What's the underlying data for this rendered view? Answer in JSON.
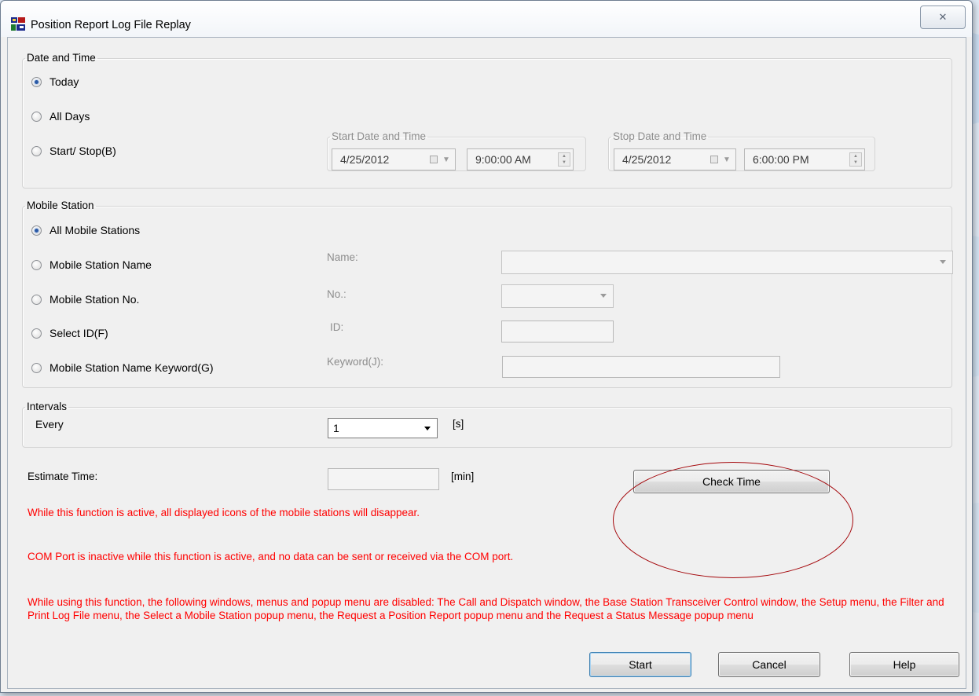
{
  "window": {
    "title": "Position Report Log File Replay",
    "close_glyph": "✕"
  },
  "date_time": {
    "legend": "Date and Time",
    "options": [
      {
        "label": "Today",
        "checked": true
      },
      {
        "label": "All Days",
        "checked": false
      },
      {
        "label": "Start/ Stop(B)",
        "checked": false
      }
    ],
    "start": {
      "legend": "Start Date and Time",
      "date": "4/25/2012",
      "time": "9:00:00 AM"
    },
    "stop": {
      "legend": "Stop Date and Time",
      "date": "4/25/2012",
      "time": "6:00:00 PM"
    }
  },
  "mobile_station": {
    "legend": "Mobile Station",
    "options": [
      {
        "label": "All Mobile Stations",
        "checked": true
      },
      {
        "label": "Mobile Station Name",
        "checked": false
      },
      {
        "label": "Mobile Station No.",
        "checked": false
      },
      {
        "label": "Select ID(F)",
        "checked": false
      },
      {
        "label": "Mobile Station Name Keyword(G)",
        "checked": false
      }
    ],
    "fields": {
      "name_label": "Name:",
      "no_label": "No.:",
      "id_label": "ID:",
      "keyword_label": "Keyword(J):"
    }
  },
  "intervals": {
    "legend": "Intervals",
    "every_label": "Every",
    "value": "1",
    "unit": "[s]"
  },
  "estimate": {
    "label": "Estimate Time:",
    "value": "",
    "unit": "[min]",
    "check_button": "Check Time"
  },
  "warnings": [
    "While this function is active, all displayed icons of the mobile stations will disappear.",
    "COM Port is inactive while this function is active, and no data can be sent or received via the COM port.",
    "While using this function, the following windows, menus and popup menu are disabled:  The Call and Dispatch window, the Base Station Transceiver Control window, the Setup menu, the Filter and Print Log File menu, the Select a Mobile Station popup menu, the Request a Position Report popup menu and the Request a Status Message popup menu"
  ],
  "buttons": {
    "start": "Start",
    "cancel": "Cancel",
    "help": "Help"
  },
  "colors": {
    "warning": "#ff0000",
    "annotation": "#a4070b",
    "radio_selected": "#2b5aa6"
  }
}
